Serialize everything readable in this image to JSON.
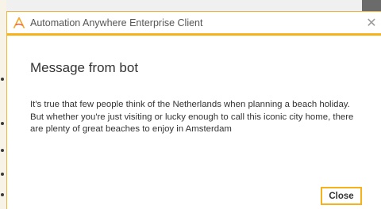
{
  "window": {
    "title": "Automation Anywhere Enterprise Client",
    "logo_icon": "automation-anywhere-logo",
    "close_icon": "close-icon",
    "close_glyph": "✕",
    "accent_color": "#f7b219"
  },
  "message": {
    "heading": "Message from bot",
    "body": "It's true that few people think of the Netherlands when planning a beach holiday. But whether you're just visiting or lucky enough to call this iconic city home, there are plenty of great beaches to enjoy in Amsterdam"
  },
  "buttons": {
    "close_label": "Close"
  }
}
